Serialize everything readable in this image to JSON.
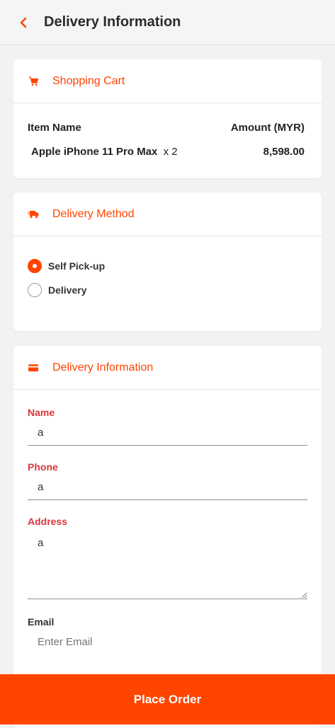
{
  "header": {
    "title": "Delivery Information"
  },
  "cart": {
    "title": "Shopping Cart",
    "col_item": "Item Name",
    "col_amount": "Amount (MYR)",
    "items": [
      {
        "name": "Apple iPhone 11 Pro Max",
        "qty": "x 2",
        "amount": "8,598.00"
      }
    ]
  },
  "delivery_method": {
    "title": "Delivery Method",
    "options": [
      {
        "label": "Self Pick-up",
        "selected": true
      },
      {
        "label": "Delivery",
        "selected": false
      }
    ]
  },
  "delivery_info": {
    "title": "Delivery Information",
    "name_label": "Name",
    "name_value": "a",
    "phone_label": "Phone",
    "phone_value": "a",
    "address_label": "Address",
    "address_value": "a",
    "email_label": "Email",
    "email_placeholder": "Enter Email"
  },
  "footer": {
    "place_order_label": "Place Order"
  },
  "colors": {
    "accent": "#ff4500",
    "required_label": "#d6383d"
  }
}
